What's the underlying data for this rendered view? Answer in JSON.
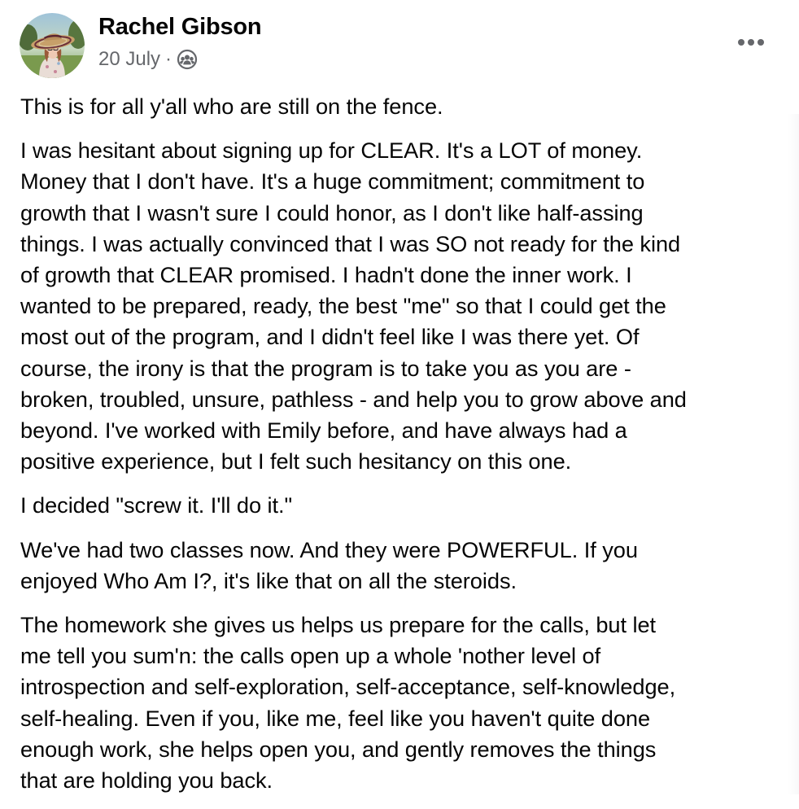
{
  "post": {
    "author": "Rachel Gibson",
    "date": "20 July",
    "separator": "·",
    "audience_icon": "group-audience-icon",
    "more_icon": "more-horizontal-icon",
    "paragraphs": [
      "This is for all y'all who are still on the fence.",
      "I was hesitant about signing up for CLEAR. It's a LOT of money.\nMoney that I don't have. It's a huge commitment; commitment to\ngrowth that I wasn't sure I could honor, as I don't like half-assing\nthings. I was actually convinced that I was SO not ready for the kind\nof growth that CLEAR promised. I hadn't done the inner work. I\nwanted to be prepared, ready, the best \"me\" so that I could get the\nmost out of the program, and I didn't feel like I was there yet. Of\ncourse, the irony is that the program is to take you as you are -\nbroken, troubled, unsure, pathless - and help you to grow above and\nbeyond. I've worked with Emily before, and have always had a\npositive experience, but I felt such hesitancy on this one.",
      "I decided \"screw it. I'll do it.\"",
      "We've had two classes now. And they were POWERFUL. If you\nenjoyed Who Am I?, it's like that on all the steroids.",
      "The homework she gives us helps us prepare for the calls, but let\nme tell you sum'n: the calls open up a whole 'nother level of\nintrospection and self-exploration, self-acceptance, self-knowledge,\nself-healing. Even if you, like me, feel like you haven't quite done\nenough work, she helps open you, and gently removes the things\nthat are holding you back."
    ]
  },
  "colors": {
    "text": "#050505",
    "secondary_text": "#65676b",
    "background": "#ffffff"
  }
}
